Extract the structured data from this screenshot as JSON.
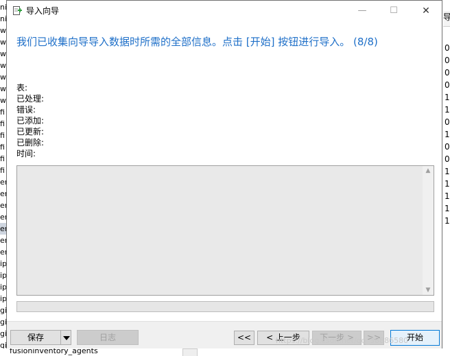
{
  "background_app": {
    "left_rows": [
      "ni",
      "ni",
      "w",
      "w",
      "w",
      "w",
      "w",
      "w",
      "w",
      "fi",
      "fi",
      "fi",
      "fi",
      "fi",
      "fi",
      "er",
      "er",
      "er",
      "er",
      "er",
      "er",
      "er",
      "ip",
      "ip",
      "ip",
      "ip",
      "gi",
      "gi",
      "gi",
      "gi"
    ],
    "right_header": "导",
    "right_rows": [
      "0",
      "0",
      "0",
      "0",
      "1",
      "1",
      "0",
      "1",
      "0",
      "0",
      "1",
      "1",
      "1",
      "1",
      "1"
    ],
    "bottom_row_text": "fusioninventory_agents"
  },
  "dialog": {
    "title": "导入向导",
    "heading": "我们已收集向导导入数据时所需的全部信息。点击 [开始] 按钮进行导入。 (8/8)",
    "stats": {
      "table": "表:",
      "processed": "已处理:",
      "errors": "错误:",
      "added": "已添加:",
      "updated": "已更新:",
      "deleted": "已删除:",
      "time": "时间:"
    },
    "log_text": "",
    "progress": 0,
    "buttons": {
      "save": "保存",
      "log": "日志",
      "first": "<<",
      "prev": "< 上一步",
      "next": "下一步 >",
      "last": ">>",
      "start": "开始"
    },
    "window_controls": {
      "minimize": "—",
      "maximize": "☐",
      "close": "✕"
    },
    "watermark": "https://blog.csdn.net/qq_38886580"
  },
  "colors": {
    "heading": "#1e6fc8",
    "accent": "#0078d7",
    "icon_green": "#2e9e3e"
  }
}
